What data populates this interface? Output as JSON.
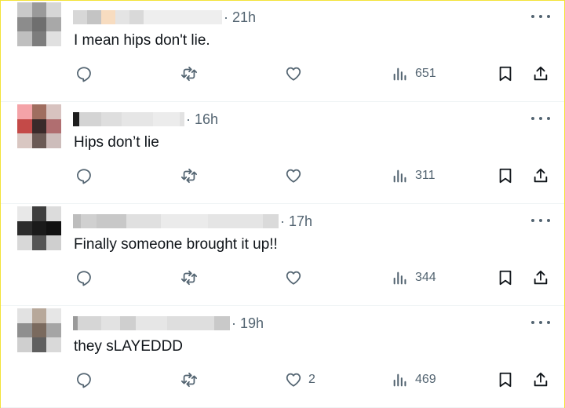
{
  "tweets": [
    {
      "time": "· 21h",
      "text": "I mean hips don't lie.",
      "likes": "",
      "views": "651",
      "avatar_colors": [
        "#c9c9c9",
        "#9a9a9a",
        "#d6d6d6",
        "#8c8c8c",
        "#6f6f6f",
        "#a8a8a8",
        "#bfbfbf",
        "#7d7d7d",
        "#e0e0e0"
      ],
      "name_blocks": [
        "#d7d7d7",
        "#c4c4c4",
        "#f7dcc0",
        "#e4e4e4",
        "#d9d9d9",
        "#eeeeee"
      ]
    },
    {
      "time": "· 16h",
      "text": "Hips don’t lie",
      "likes": "",
      "views": "311",
      "avatar_colors": [
        "#f4a3a8",
        "#a06e60",
        "#d8c3c0",
        "#c44a48",
        "#3a2a2a",
        "#b06e70",
        "#d9c7c2",
        "#6b5a55",
        "#cdbdbb"
      ],
      "name_blocks": [
        "#1e1e1e",
        "#d4d4d4",
        "#dedede",
        "#e6e6e6",
        "#ececec",
        "#e2e2e2"
      ]
    },
    {
      "time": "· 17h",
      "text": "Finally someone brought it up!!",
      "likes": "",
      "views": "344",
      "avatar_colors": [
        "#e8e8e8",
        "#3f3f3f",
        "#dcdcdc",
        "#2c2c2c",
        "#1a1a1a",
        "#111111",
        "#d8d8d8",
        "#555555",
        "#cfcfcf"
      ],
      "name_blocks": [
        "#bdbdbd",
        "#d0d0d0",
        "#c8c8c8",
        "#e0e0e0",
        "#ebebeb",
        "#e5e5e5",
        "#dadada"
      ]
    },
    {
      "time": "· 19h",
      "text": "they sLAYEDDD",
      "likes": "2",
      "views": "469",
      "avatar_colors": [
        "#e2e2e2",
        "#b7a89a",
        "#e6e6e6",
        "#8f8f8f",
        "#7a6a5e",
        "#a5a5a5",
        "#cfcfcf",
        "#5f5f5f",
        "#d9d9d9"
      ],
      "name_blocks": [
        "#9a9a9a",
        "#d6d6d6",
        "#e2e2e2",
        "#cfcfcf",
        "#e6e6e6",
        "#dedede",
        "#c9c9c9"
      ]
    }
  ],
  "icons": {
    "reply": "reply-icon",
    "retweet": "retweet-icon",
    "like": "heart-icon",
    "views": "views-icon",
    "bookmark": "bookmark-icon",
    "share": "share-icon",
    "more": "more-icon"
  },
  "colors": {
    "secondary_text": "#536471",
    "divider": "#eff3f4",
    "frame_border": "#f3e33a"
  }
}
